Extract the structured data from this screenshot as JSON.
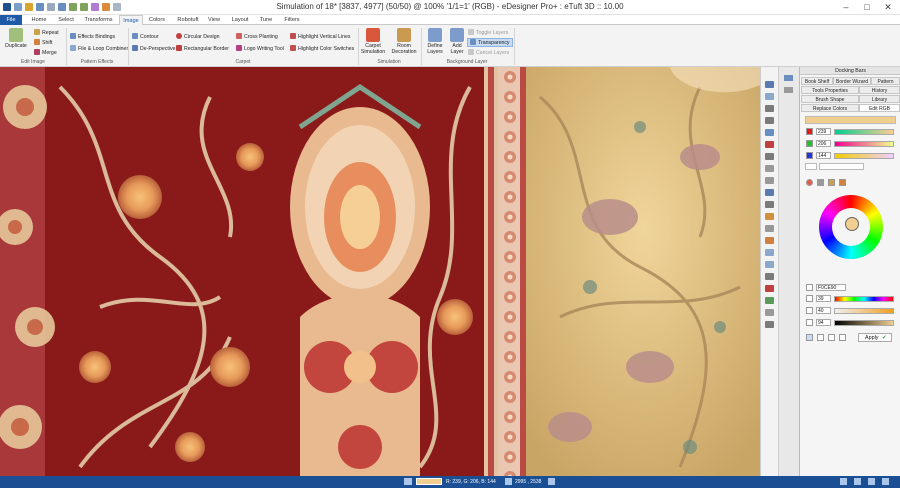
{
  "window": {
    "title": "Simulation of 18* [3837, 4977] (50/50) @ 100% '1/1=1' (RGB) - eDesigner Pro+ : eTuft 3D :: 10.00"
  },
  "menu": {
    "tabs": [
      "File",
      "Home",
      "Select",
      "Transforms",
      "Image",
      "Colors",
      "Robotuft",
      "View",
      "Layout",
      "Tune",
      "Filters"
    ],
    "active": "Image"
  },
  "ribbon": {
    "edit_image": {
      "duplicate": "Duplicate",
      "repeat": "Repeat",
      "shift": "Shift",
      "merge": "Merge",
      "group": "Edit Image"
    },
    "pattern_effects": {
      "effects_bindings": "Effects Bindings",
      "file_loop_combiner": "File & Loop Combiner",
      "group": "Pattern Effects"
    },
    "carpet": {
      "contour": "Contour",
      "de_perspective": "De-Perspective",
      "circular_design": "Circular Design",
      "rectangular_border": "Rectangular Border",
      "cross_planting": "Cross Planting",
      "logo_writing_tool": "Logo Writing Tool",
      "highlight_vertical_lines": "Highlight Vertical Lines",
      "highlight_color_switches": "Highlight Color Switches",
      "group": "Carpet"
    },
    "simulation": {
      "carpet_simulation": [
        "Carpet",
        "Simulation"
      ],
      "room_decoration": [
        "Room",
        "Decoration"
      ],
      "group": "Simulation"
    },
    "background_layer": {
      "define_layers": [
        "Define",
        "Layers"
      ],
      "add_layer": [
        "Add",
        "Layer"
      ],
      "toggle_layers": "Toggle Layers",
      "transparency": "Transparency",
      "cancel_layers": "Cancel Layers",
      "group": "Background Layer"
    }
  },
  "panel": {
    "title": "Docking Bars",
    "tabs_row1": [
      "Book Shelf",
      "Border Wizard",
      "Pattern"
    ],
    "tabs_row2": [
      "Tools Properties",
      "History"
    ],
    "tabs_row3": [
      "Brush Shape",
      "Library"
    ],
    "tabs_row4": [
      "Replace Colors",
      "Edit RGB"
    ],
    "rgb": {
      "r": "239",
      "g": "206",
      "b": "144"
    },
    "hex": "F0CE90",
    "hsv": {
      "h": "39",
      "s": "40",
      "v": "94"
    },
    "apply": "Apply"
  },
  "colors": {
    "current": "#efce90",
    "accent": "#1f5aa6",
    "status_bg": "#1b4f94"
  },
  "status": {
    "rgb_text": "R: 239, G: 206, B: 144",
    "coords": "2995 , 2538"
  }
}
